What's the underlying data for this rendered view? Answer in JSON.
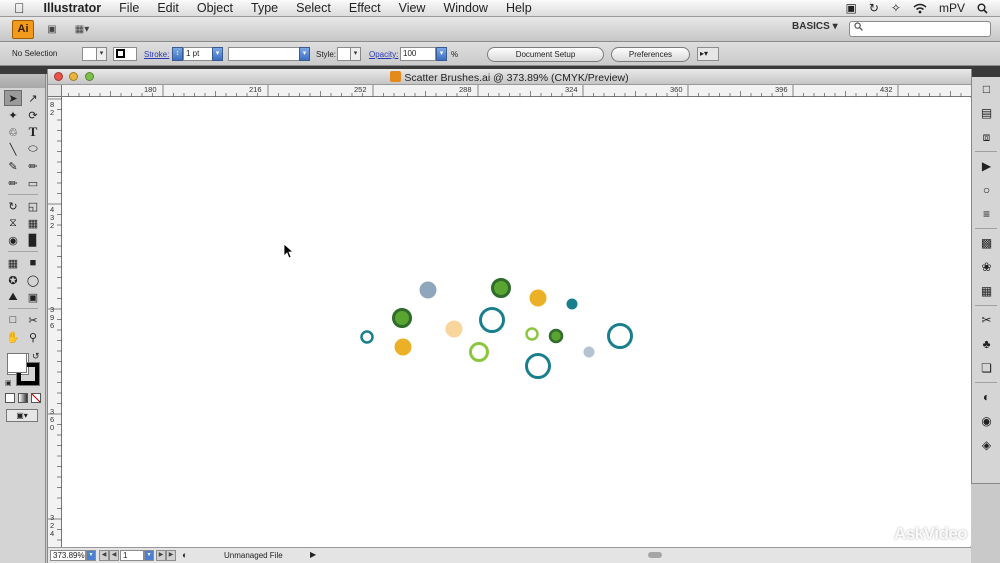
{
  "menubar": {
    "apple_icon": "apple-icon",
    "app_name": "Illustrator",
    "items": [
      "File",
      "Edit",
      "Object",
      "Type",
      "Select",
      "Effect",
      "View",
      "Window",
      "Help"
    ],
    "right_status": "mPV"
  },
  "appbar": {
    "logo": "Ai",
    "workspace": "BASICS",
    "search_placeholder": ""
  },
  "control": {
    "selection_label": "No Selection",
    "stroke_label": "Stroke:",
    "stroke_value": "1 pt",
    "style_label": "Style:",
    "opacity_label": "Opacity:",
    "opacity_value": "100",
    "opacity_unit": "%",
    "document_setup": "Document Setup",
    "preferences": "Preferences"
  },
  "document": {
    "title": "Scatter Brushes.ai @ 373.89% (CMYK/Preview)",
    "ruler_h": [
      "180",
      "216",
      "252",
      "288",
      "324",
      "360",
      "396",
      "432"
    ],
    "ruler_v": [
      "8",
      "2",
      "4",
      "3",
      "2",
      "3",
      "9",
      "6",
      "3",
      "6",
      "0",
      "3",
      "2",
      "4"
    ]
  },
  "status": {
    "zoom": "373.89%",
    "page": "1",
    "info": "Unmanaged File"
  },
  "colors": {
    "teal": "#1a7f8c",
    "green": "#5aa532",
    "light_green": "#8cc63f",
    "gold": "#ebb025",
    "peach": "#f8d59a",
    "blue_gray": "#8ea7bc"
  },
  "watermark": "AskVideo"
}
